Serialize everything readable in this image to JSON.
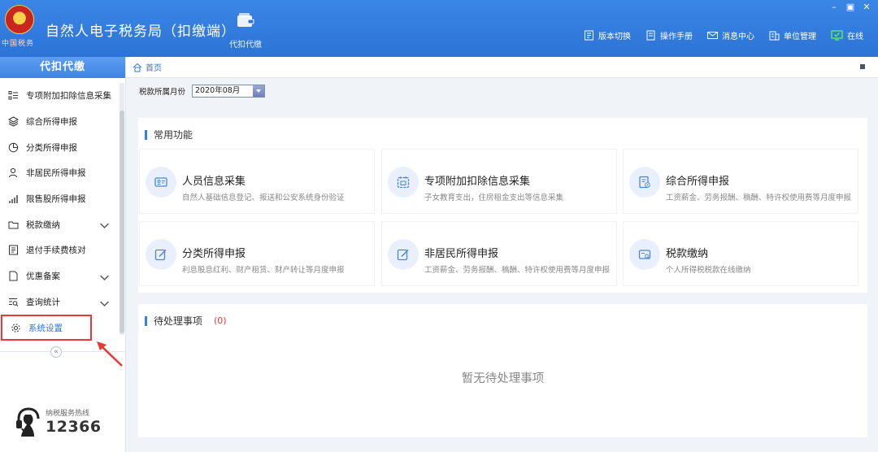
{
  "header": {
    "emblem_text": "中国税务",
    "app_title": "自然人电子税务局（扣缴端）",
    "module_label": "代扣代缴",
    "window_controls": [
      "–",
      "▣",
      "✕"
    ],
    "toolbar": [
      {
        "label": "版本切换",
        "icon": "version-switch-icon"
      },
      {
        "label": "操作手册",
        "icon": "manual-icon"
      },
      {
        "label": "消息中心",
        "icon": "message-icon"
      },
      {
        "label": "单位管理",
        "icon": "company-icon"
      },
      {
        "label": "在线",
        "icon": "online-icon"
      }
    ],
    "online_color": "#5df26a"
  },
  "sidebar": {
    "title": "代扣代缴",
    "items": [
      {
        "label": "专项附加扣除信息采集",
        "icon": "list-icon"
      },
      {
        "label": "综合所得申报",
        "icon": "layers-icon"
      },
      {
        "label": "分类所得申报",
        "icon": "pie-icon"
      },
      {
        "label": "非居民所得申报",
        "icon": "person-icon"
      },
      {
        "label": "限售股所得申报",
        "icon": "bar-chart-icon"
      },
      {
        "label": "税款缴纳",
        "icon": "folder-icon",
        "expandable": true
      },
      {
        "label": "退付手续费核对",
        "icon": "doc-check-icon"
      },
      {
        "label": "优惠备案",
        "icon": "file-icon",
        "expandable": true
      },
      {
        "label": "查询统计",
        "icon": "search-list-icon",
        "expandable": true
      },
      {
        "label": "系统设置",
        "icon": "gear-icon",
        "selected": true
      }
    ],
    "collapse_glyph": "«",
    "hotline_label": "纳税服务热线",
    "hotline_number": "12366"
  },
  "main": {
    "breadcrumb": "首页",
    "period_label": "税款所属月份",
    "period_value": "2020年08月",
    "common_title": "常用功能",
    "cards": [
      {
        "title": "人员信息采集",
        "desc": "自然人基础信息登记、报送和公安系统身份验证",
        "icon": "id-card-icon"
      },
      {
        "title": "专项附加扣除信息采集",
        "desc": "子女教育支出，住房租金支出等信息采集",
        "icon": "calendar-tax-icon"
      },
      {
        "title": "综合所得申报",
        "desc": "工资薪金、劳务报酬、稿酬、特许权使用费等月度申报",
        "icon": "report-icon"
      },
      {
        "title": "分类所得申报",
        "desc": "利息股息红利、财产租赁、财产转让等月度申报",
        "icon": "edit-icon"
      },
      {
        "title": "非居民所得申报",
        "desc": "工资薪金、劳务报酬、稿酬、特许权使用费等月度申报",
        "icon": "edit-icon"
      },
      {
        "title": "税款缴纳",
        "desc": "个人所得税税款在线缴纳",
        "icon": "payment-icon"
      }
    ],
    "pending_title": "待处理事项",
    "pending_count": "(0)",
    "pending_empty": "暂无待处理事项"
  }
}
